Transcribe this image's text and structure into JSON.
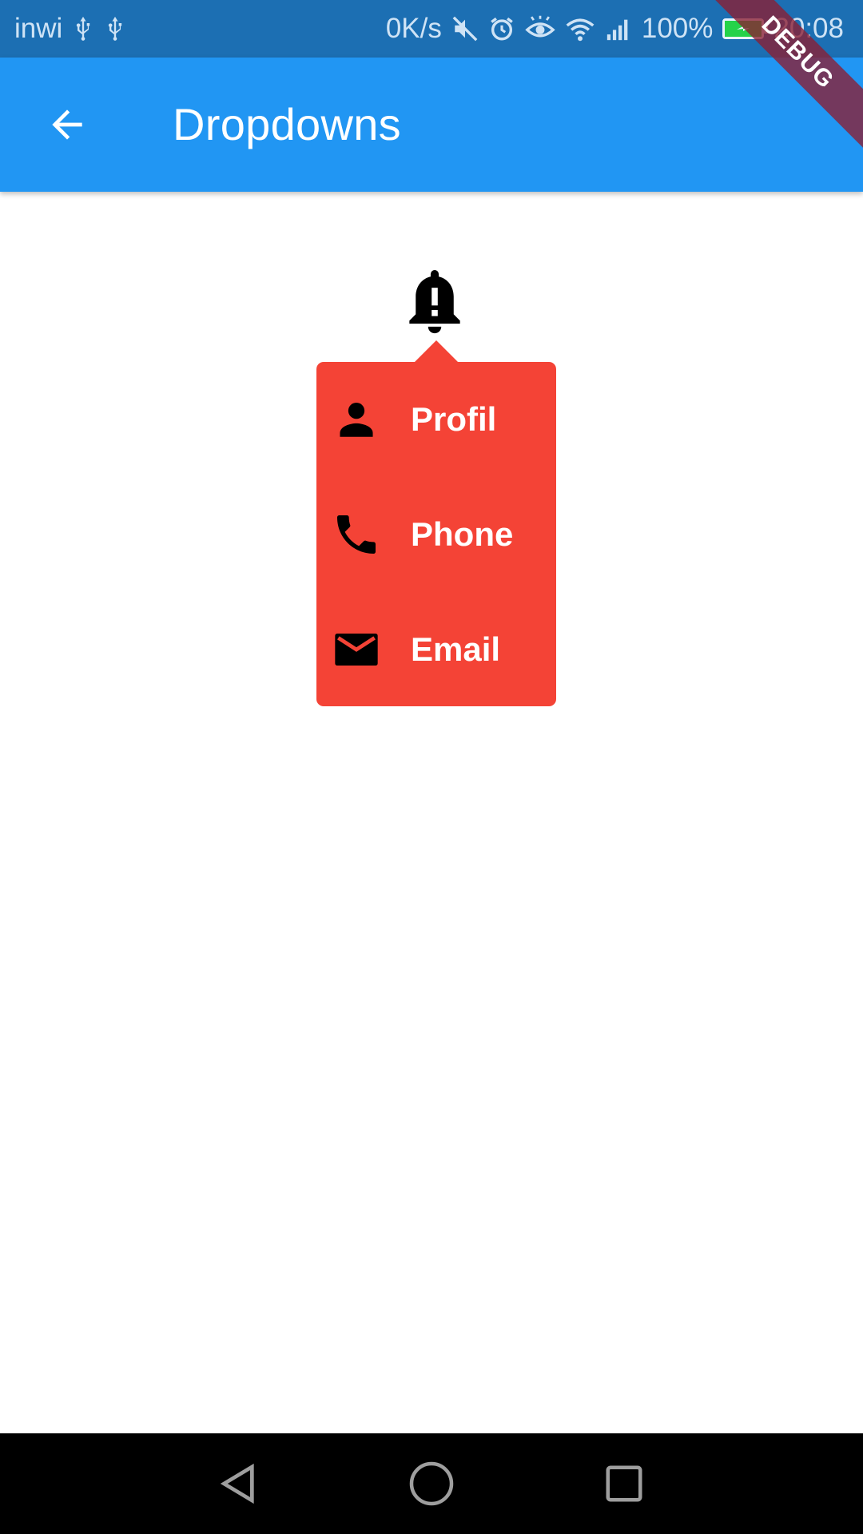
{
  "status_bar": {
    "carrier": "inwi",
    "speed": "0K/s",
    "battery_percent": "100%",
    "time": "20:08",
    "icons": [
      "usb-icon",
      "usb-icon",
      "mute-icon",
      "alarm-icon",
      "eye-icon",
      "wifi-icon",
      "signal-icon",
      "battery-charging-icon"
    ]
  },
  "app_bar": {
    "title": "Dropdowns",
    "back_icon": "arrow-back-icon",
    "color": "#2196f3"
  },
  "debug_banner": "DEBUG",
  "bell": {
    "icon": "notification-important-icon"
  },
  "dropdown": {
    "color": "#f44336",
    "items": [
      {
        "label": "Profil",
        "icon": "person-icon"
      },
      {
        "label": "Phone",
        "icon": "phone-icon"
      },
      {
        "label": "Email",
        "icon": "email-icon"
      }
    ]
  },
  "nav_bar": {
    "buttons": [
      "back-triangle-icon",
      "home-circle-icon",
      "recents-square-icon"
    ]
  }
}
